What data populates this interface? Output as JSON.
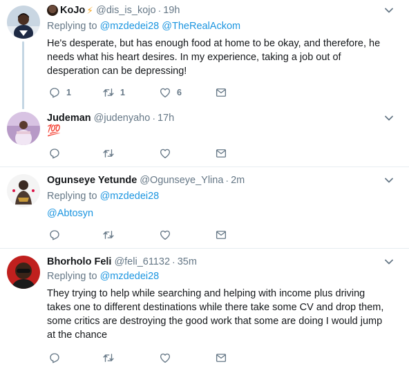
{
  "tweets": [
    {
      "name": "KoJo",
      "name_emoji": "⚡",
      "handle": "@dis_is_kojo",
      "time": "19h",
      "replying_prefix": "Replying to",
      "replying_to": [
        "@mzdedei28",
        "@TheRealAckom"
      ],
      "text": "He's desperate, but has enough food at home to be okay, and therefore, he needs what his heart desires. In my experience, taking a job out of desperation can be depressing!",
      "reply_count": "1",
      "retweet_count": "1",
      "like_count": "6"
    },
    {
      "name": "Judeman",
      "handle": "@judenyaho",
      "time": "17h",
      "text": "💯",
      "reply_count": "",
      "retweet_count": "",
      "like_count": ""
    },
    {
      "name": "Ogunseye Yetunde",
      "handle": "@Ogunseye_Ylina",
      "time": "2m",
      "replying_prefix": "Replying to",
      "replying_to": [
        "@mzdedei28"
      ],
      "text": "@Abtosyn",
      "reply_count": "",
      "retweet_count": "",
      "like_count": ""
    },
    {
      "name": "Bhorholo Feli",
      "handle": "@feli_61132",
      "time": "35m",
      "replying_prefix": "Replying to",
      "replying_to": [
        "@mzdedei28"
      ],
      "text": "They trying to help while searching and helping with income plus driving takes one to different destinations while there take some CV and drop them, some critics are destroying the good work that some are doing I would jump at the chance",
      "reply_count": "",
      "retweet_count": "",
      "like_count": ""
    }
  ],
  "icons": {
    "reply": "reply-icon",
    "retweet": "retweet-icon",
    "like": "heart-icon",
    "message": "direct-message-icon",
    "caret": "chevron-down-icon"
  },
  "colors": {
    "link": "#1b95e0",
    "secondary": "#657786",
    "thread_line": "#c4d6e3",
    "divider": "#e6ecf0"
  }
}
